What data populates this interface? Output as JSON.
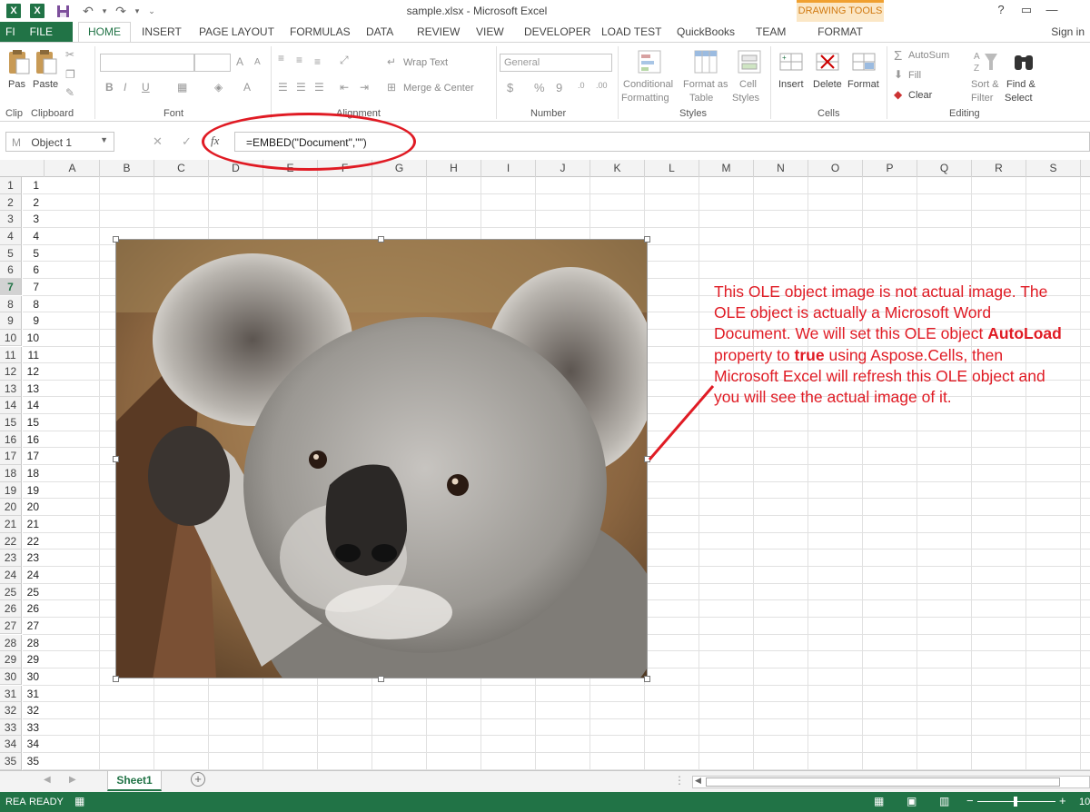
{
  "titlebar": {
    "title": "sample.xlsx - Microsoft Excel",
    "context_group": "DRAWING TOOLS",
    "help": "?",
    "restore": "▭",
    "minimize": "—"
  },
  "tabs": {
    "file_tab_partial": "FI",
    "file": "FILE",
    "items": [
      "HOME",
      "INSERT",
      "PAGE LAYOUT",
      "FORMULAS",
      "DATA",
      "REVIEW",
      "VIEW",
      "DEVELOPER",
      "LOAD TEST",
      "QuickBooks",
      "TEAM"
    ],
    "format": "FORMAT",
    "signin": "Sign in"
  },
  "ribbon": {
    "clipboard": {
      "paste_partial": "Pas",
      "paste": "Paste",
      "group_partial": "Clip",
      "group": "Clipboard"
    },
    "font": {
      "group": "Font",
      "bold": "B",
      "italic": "I",
      "underline": "U",
      "grow": "A",
      "shrink": "A"
    },
    "alignment": {
      "wrap_text": "Wrap Text",
      "merge_center": "Merge & Center",
      "group": "Alignment"
    },
    "number": {
      "format": "General",
      "currency": "$",
      "percent": "%",
      "comma": "9",
      "inc_dec": ".0",
      "dec_dec": ".00",
      "group": "Number"
    },
    "styles": {
      "conditional_1": "Conditional",
      "conditional_2": "Formatting",
      "format_as_1": "Format as",
      "format_as_2": "Table",
      "cell_styles_1": "Cell",
      "cell_styles_2": "Styles",
      "group": "Styles"
    },
    "cells": {
      "insert": "Insert",
      "delete": "Delete",
      "format": "Format",
      "group": "Cells"
    },
    "editing": {
      "autosum": "AutoSum",
      "fill": "Fill",
      "clear": "Clear",
      "sort_1": "Sort &",
      "sort_2": "Filter",
      "find_1": "Find &",
      "find_2": "Select",
      "group": "Editing"
    }
  },
  "formula_bar": {
    "namebox_partial": "M",
    "namebox": "Object 1",
    "cancel": "✕",
    "enter": "✓",
    "fx": "fx",
    "formula": "=EMBED(\"Document\",\"\")"
  },
  "grid": {
    "columns": [
      "A",
      "B",
      "C",
      "D",
      "E",
      "F",
      "G",
      "H",
      "I",
      "J",
      "K",
      "L",
      "M",
      "N",
      "O",
      "P",
      "Q",
      "R",
      "S"
    ],
    "row_numbers": [
      "1",
      "2",
      "3",
      "4",
      "5",
      "6",
      "7",
      "8",
      "9",
      "10",
      "11",
      "12",
      "13",
      "14",
      "15",
      "16",
      "17",
      "18",
      "19",
      "20",
      "21",
      "22",
      "23",
      "24",
      "25",
      "26",
      "27",
      "28",
      "29",
      "30",
      "31",
      "32",
      "33",
      "34",
      "35"
    ],
    "column_a_values": [
      "1",
      "2",
      "3",
      "4",
      "5",
      "6",
      "7",
      "8",
      "9",
      "10",
      "11",
      "12",
      "13",
      "14",
      "15",
      "16",
      "17",
      "18",
      "19",
      "20",
      "21",
      "22",
      "23",
      "24",
      "25",
      "26",
      "27",
      "28",
      "29",
      "30",
      "31",
      "32",
      "33",
      "34",
      "35"
    ],
    "selected_row": "7"
  },
  "annotation": {
    "part1": "This OLE object image is not actual image. The OLE object is actually a Microsoft Word Document. We will set this OLE object ",
    "bold1": "AutoLoad",
    "part2": " property to ",
    "bold2": "true",
    "part3": " using Aspose.Cells, then Microsoft Excel will refresh this OLE object and you will see the actual image of it."
  },
  "sheets": {
    "active": "Sheet1",
    "add": "+"
  },
  "statusbar": {
    "partial": "REA",
    "ready": "READY",
    "zoom": "10"
  },
  "colors": {
    "excel_green": "#217346",
    "annotation_red": "#e01b24",
    "context_orange": "#d17a11"
  },
  "icons": [
    "excel-logo-icon",
    "save-icon",
    "undo-icon",
    "redo-icon",
    "paste-icon",
    "koala-picture"
  ]
}
